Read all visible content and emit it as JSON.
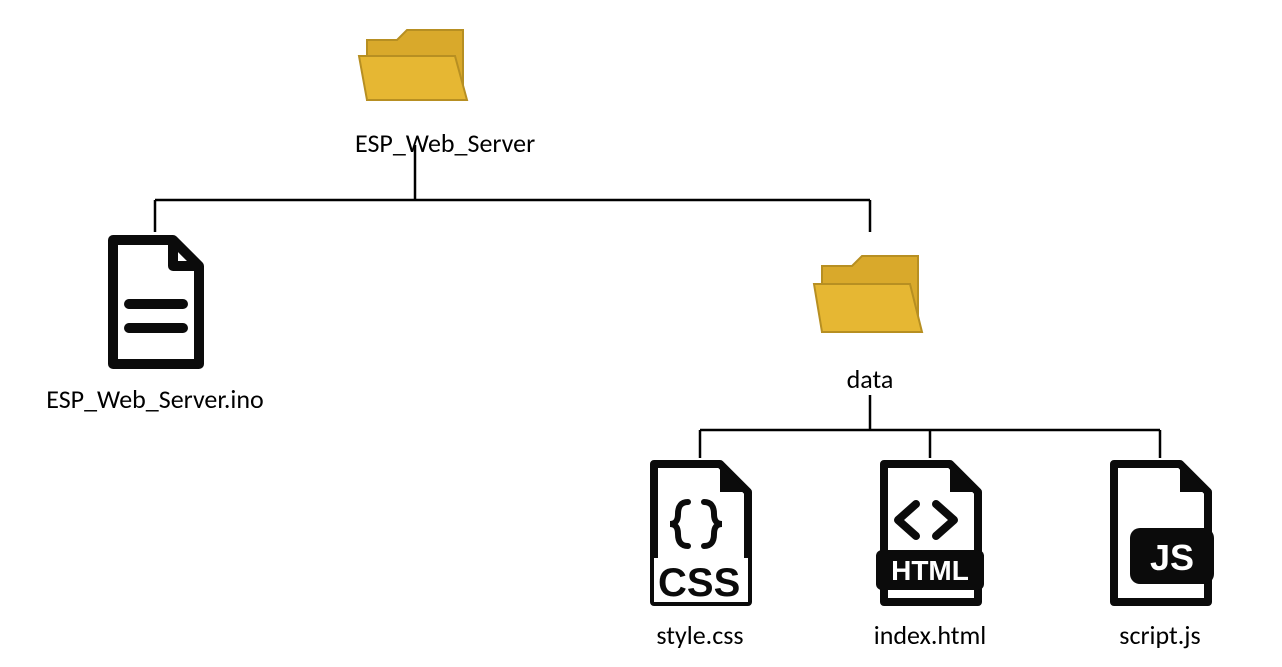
{
  "diagram": {
    "root": {
      "label": "ESP_Web_Server",
      "type": "folder"
    },
    "children": [
      {
        "key": "ino",
        "label": "ESP_Web_Server.ino",
        "type": "file-code"
      },
      {
        "key": "data",
        "label": "data",
        "type": "folder",
        "children": [
          {
            "key": "css",
            "label": "style.css",
            "type": "file-css"
          },
          {
            "key": "html",
            "label": "index.html",
            "type": "file-html"
          },
          {
            "key": "js",
            "label": "script.js",
            "type": "file-js"
          }
        ]
      }
    ]
  },
  "colors": {
    "folder_fill": "#D9A92B",
    "folder_stroke": "#B78F22",
    "icon_stroke": "#0B0B0B",
    "line": "#000000"
  }
}
